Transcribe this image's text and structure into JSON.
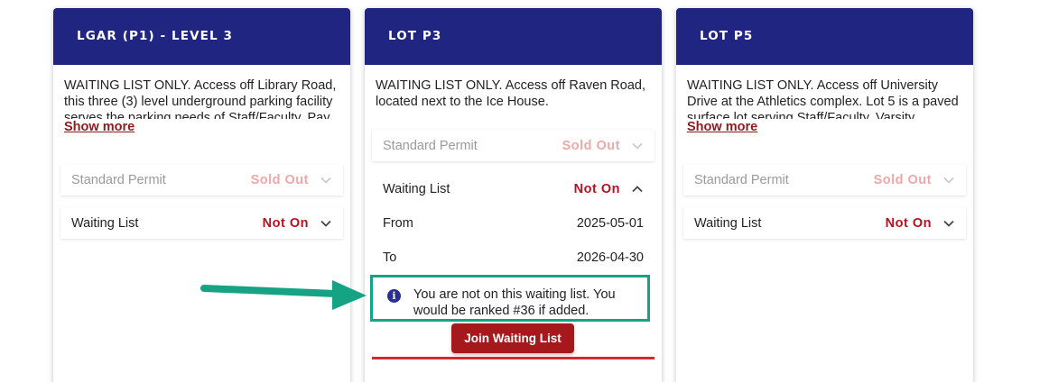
{
  "cards": [
    {
      "title": "LGAR (P1) - LEVEL 3",
      "description": "WAITING LIST ONLY. Access off Library Road, this three (3) level underground parking facility serves the parking needs of Staff/Faculty. Pay",
      "show_more": "Show more",
      "rows": [
        {
          "label": "Standard Permit",
          "status": "Sold Out",
          "state": "disabled",
          "chevron": "chevron-down-icon"
        },
        {
          "label": "Waiting List",
          "status": "Not On",
          "state": "active",
          "chevron": "chevron-down-icon"
        }
      ]
    },
    {
      "title": "LOT P3",
      "description": "WAITING LIST ONLY. Access off Raven Road, located next to the Ice House.",
      "rows": [
        {
          "label": "Standard Permit",
          "status": "Sold Out",
          "state": "disabled",
          "chevron": "chevron-down-icon"
        },
        {
          "label": "Waiting List",
          "status": "Not On",
          "state": "active",
          "chevron": "chevron-up-icon"
        }
      ],
      "details": [
        {
          "label": "From",
          "value": "2025-05-01"
        },
        {
          "label": "To",
          "value": "2026-04-30"
        }
      ],
      "notice": "You are not on this waiting list. You would be ranked #36 if added.",
      "notice_icon": "info-icon",
      "join_button": "Join Waiting List"
    },
    {
      "title": "LOT P5",
      "description": "WAITING LIST ONLY. Access off University Drive at the Athletics complex. Lot 5 is a paved surface lot serving Staff/Faculty, Varsity",
      "show_more": "Show more",
      "rows": [
        {
          "label": "Standard Permit",
          "status": "Sold Out",
          "state": "disabled",
          "chevron": "chevron-down-icon"
        },
        {
          "label": "Waiting List",
          "status": "Not On",
          "state": "active",
          "chevron": "chevron-down-icon"
        }
      ]
    }
  ],
  "annotation": {
    "type": "arrow",
    "color": "#15a384",
    "icon": "arrow-right-icon"
  },
  "colors": {
    "header": "#1f2580",
    "status_active": "#b3121f",
    "status_disabled": "#f0a7a7",
    "button": "#a5191d",
    "highlight": "#15a384"
  }
}
